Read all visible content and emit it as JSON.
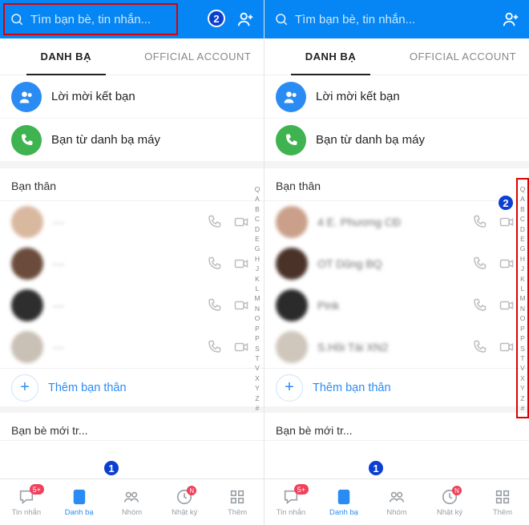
{
  "search": {
    "placeholder": "Tìm bạn bè, tin nhắn..."
  },
  "tabs": {
    "contacts": "DANH BẠ",
    "official": "OFFICIAL ACCOUNT"
  },
  "rows": {
    "friend_req": "Lời mời kết bạn",
    "phone_contacts": "Bạn từ danh bạ máy"
  },
  "sections": {
    "close_friends": "Bạn thân",
    "new_friends": "Bạn bè mới tr...",
    "add_close": "Thêm bạn thân"
  },
  "contacts_left": [
    {
      "name": "···",
      "avatar": "#d9b8a0"
    },
    {
      "name": "···",
      "avatar": "#6b4b3b"
    },
    {
      "name": "···",
      "avatar": "#2e2e2e"
    },
    {
      "name": "···",
      "avatar": "#c9c0b6"
    }
  ],
  "contacts_right": [
    {
      "name": "4 E. Phương CĐ",
      "avatar": "#caa08a"
    },
    {
      "name": "OT Dũng BQ",
      "avatar": "#4a3228"
    },
    {
      "name": "Pink",
      "avatar": "#2b2b2b"
    },
    {
      "name": "S.Hồi Tài XN2",
      "avatar": "#cfc6bc"
    }
  ],
  "az": [
    "Q",
    "A",
    "B",
    "C",
    "D",
    "E",
    "G",
    "H",
    "J",
    "K",
    "L",
    "M",
    "N",
    "O",
    "P",
    "P",
    "S",
    "T",
    "V",
    "X",
    "Y",
    "Z",
    "#"
  ],
  "bottom": {
    "items": [
      {
        "key": "messages",
        "label": "Tin nhắn",
        "badge": "5+"
      },
      {
        "key": "contacts",
        "label": "Danh bạ"
      },
      {
        "key": "groups",
        "label": "Nhóm"
      },
      {
        "key": "timeline",
        "label": "Nhật ký",
        "dot": "N"
      },
      {
        "key": "more",
        "label": "Thêm"
      }
    ]
  },
  "annotations": {
    "one": "1",
    "two": "2"
  }
}
